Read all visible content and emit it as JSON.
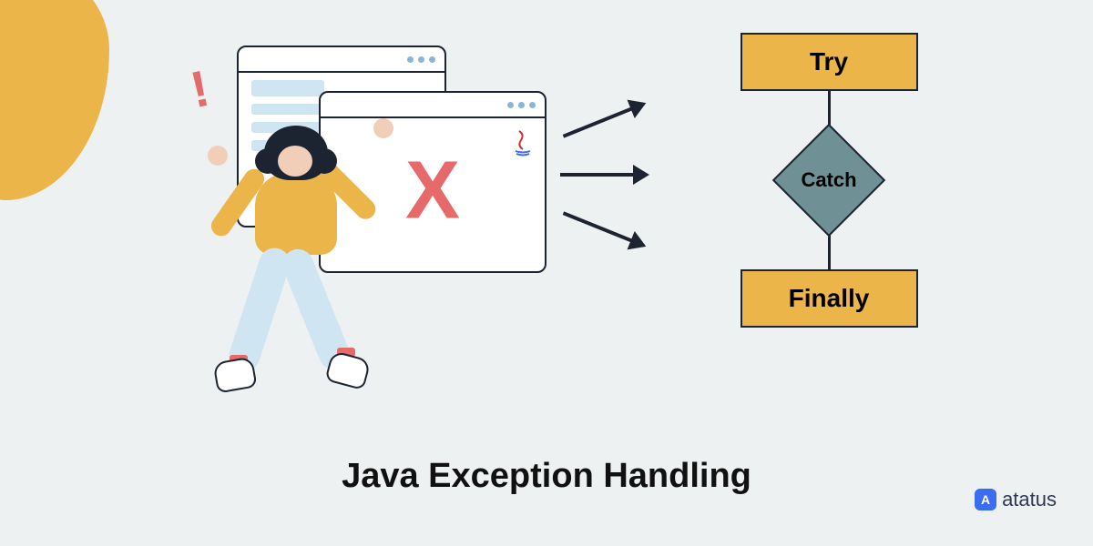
{
  "title": "Java Exception Handling",
  "flowchart": {
    "try": "Try",
    "catch": "Catch",
    "finally": "Finally"
  },
  "illustration": {
    "error_symbol": "X",
    "exclaim": "!",
    "java_icon": "java-logo"
  },
  "brand": {
    "name": "atatus",
    "icon_glyph": "A"
  },
  "colors": {
    "background": "#eef1f1",
    "accent_yellow": "#ebb54a",
    "accent_teal": "#6f9196",
    "accent_red": "#e66a6a",
    "outline": "#1b2430"
  }
}
